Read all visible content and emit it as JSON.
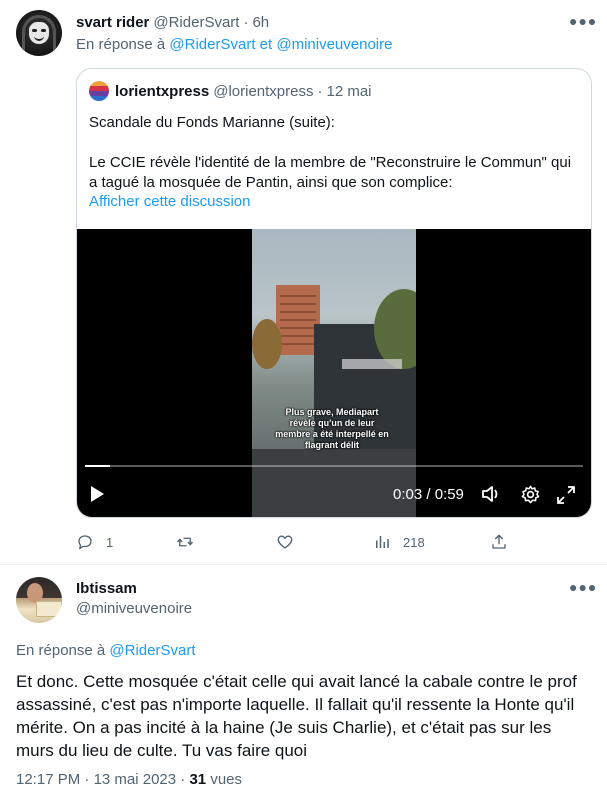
{
  "tweet1": {
    "display_name": "svart rider",
    "handle": "@RiderSvart",
    "separator": "·",
    "time": "6h",
    "reply_prefix": "En réponse à",
    "reply_users": [
      "@RiderSvart",
      "et",
      "@miniveuvenoire"
    ],
    "quote": {
      "display_name": "lorientxpress",
      "handle": "@lorientxpress",
      "separator": "·",
      "date": "12 mai",
      "paragraph1": "Scandale du Fonds Marianne (suite):",
      "paragraph2": "Le CCIE révèle l'identité de la membre de \"Reconstruire le Commun\" qui a tagué la mosquée de Pantin, ainsi que son complice:",
      "show_thread": "Afficher cette discussion",
      "video": {
        "caption": "Plus grave, Mediapart révèle qu'un de leur membre a été interpellé en flagrant délit",
        "time_display": "0:03 / 0:59",
        "progress_fraction": 0.05
      }
    },
    "actions": {
      "reply_count": "1",
      "retweet_count": "",
      "like_count": "",
      "views_count": "218"
    }
  },
  "tweet2": {
    "display_name": "Ibtissam",
    "handle": "@miniveuvenoire",
    "reply_prefix": "En réponse à",
    "reply_user": "@RiderSvart",
    "body": "Et donc. Cette mosquée c'était celle qui avait lancé la cabale contre le prof assassiné, c'est pas n'importe laquelle. Il fallait qu'il ressente la Honte qu'il mérite. On a pas incité à la haine (Je suis Charlie), et c'était pas sur les murs du lieu de culte. Tu vas faire quoi",
    "time": "12:17 PM",
    "separator": "·",
    "date": "13 mai 2023",
    "views": "31",
    "views_label": "vues"
  },
  "colors": {
    "link": "#1d9bf0",
    "secondary_text": "#536471",
    "primary_text": "#0f1419",
    "border": "#cfd9de"
  },
  "icons": [
    "more-icon",
    "play-icon",
    "volume-icon",
    "gear-icon",
    "fullscreen-icon",
    "reply-icon",
    "retweet-icon",
    "like-icon",
    "views-icon",
    "share-icon"
  ]
}
